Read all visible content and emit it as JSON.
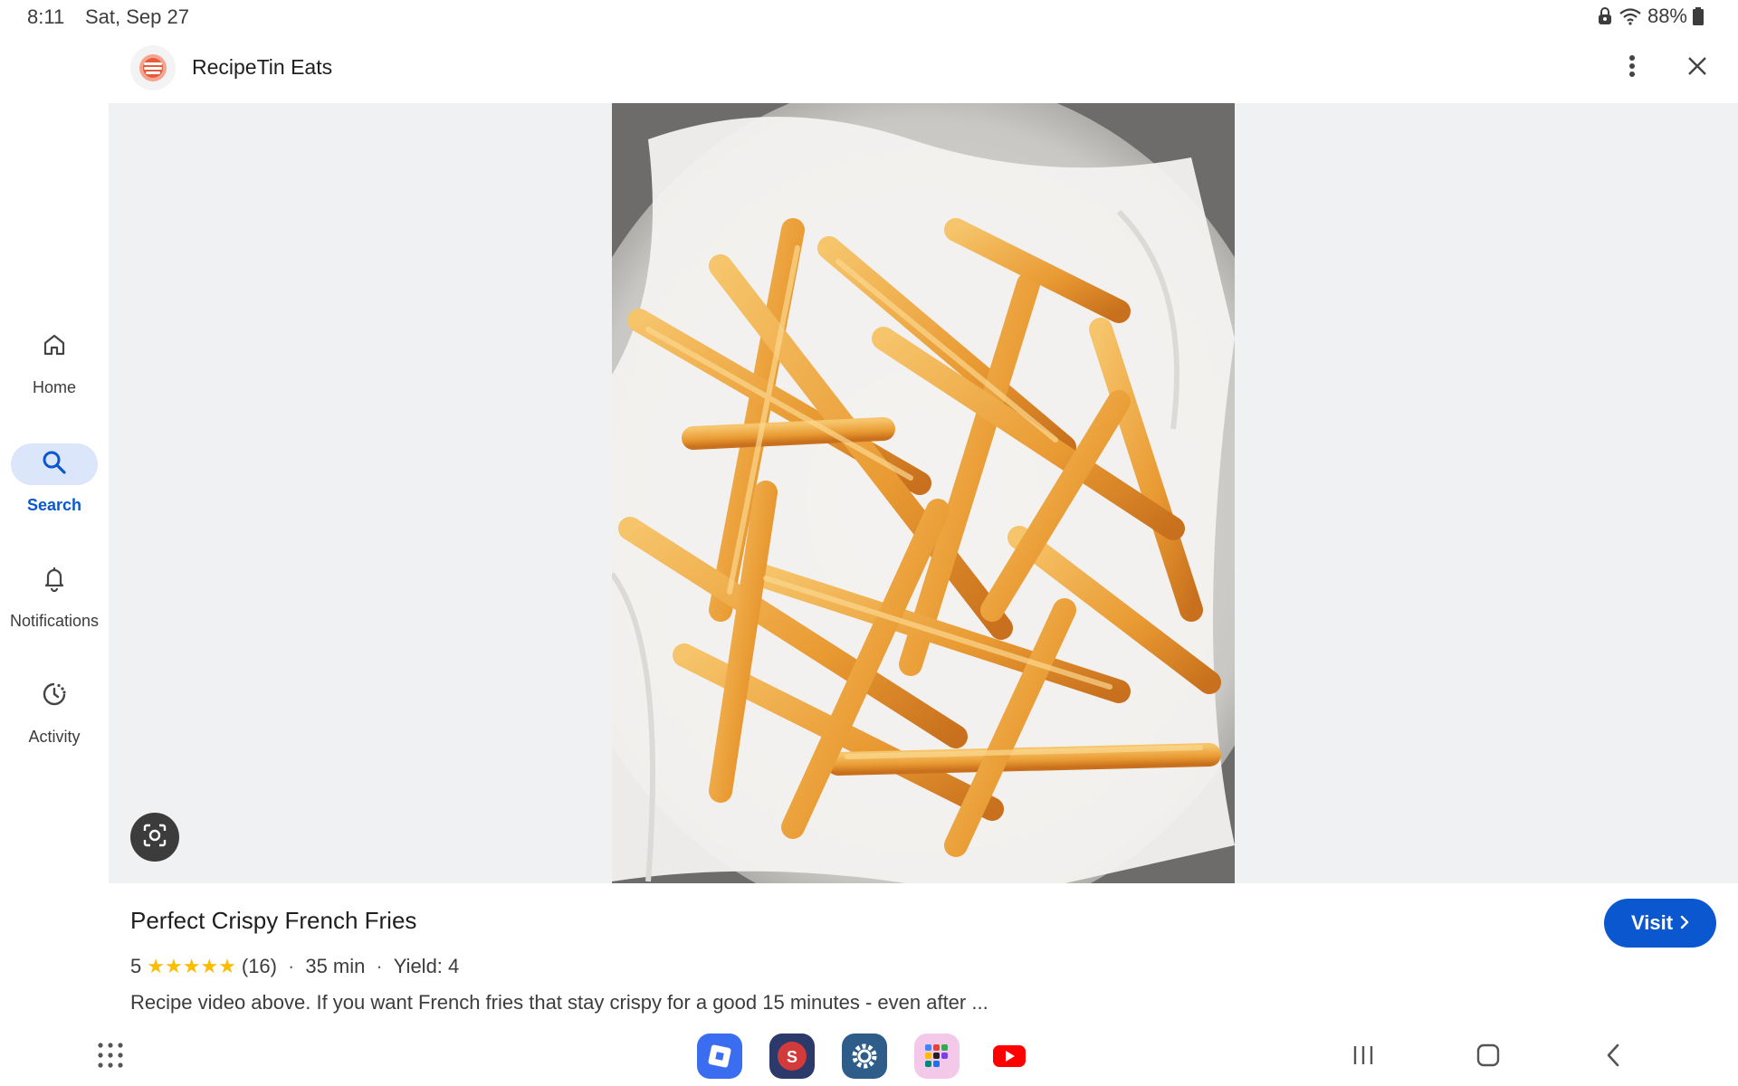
{
  "status_bar": {
    "time": "8:11",
    "date": "Sat, Sep 27",
    "battery": "88%",
    "icons": [
      "lock-icon",
      "wifi-icon",
      "battery-icon"
    ]
  },
  "header": {
    "site_name": "RecipeTin Eats",
    "logo_icon": "recipetin-logo",
    "more_icon": "more-vert-icon",
    "close_icon": "close-icon"
  },
  "nav_rail": {
    "items": [
      {
        "label": "Home",
        "icon": "home-icon",
        "active": false
      },
      {
        "label": "Search",
        "icon": "search-icon",
        "active": true
      },
      {
        "label": "Notifications",
        "icon": "bell-icon",
        "active": false
      },
      {
        "label": "Activity",
        "icon": "history-icon",
        "active": false
      }
    ]
  },
  "result": {
    "title": "Perfect Crispy French Fries",
    "rating": "5",
    "stars": "★★★★★",
    "reviews": "(16)",
    "time": "35 min",
    "yield": "Yield: 4",
    "description": "Recipe video above. If you want French fries that stay crispy for a good 15 minutes - even after ...",
    "visit_label": "Visit"
  },
  "colors": {
    "accent": "#0b57d0",
    "star": "#fbbc04",
    "viewer_bg": "#f0f1f3"
  },
  "dock": {
    "apps": [
      "roblox-app-icon",
      "app-store-icon",
      "settings-app-icon",
      "app-folder-icon",
      "youtube-app-icon"
    ]
  },
  "system_nav": [
    "recents-icon",
    "home-nav-icon",
    "back-icon"
  ]
}
